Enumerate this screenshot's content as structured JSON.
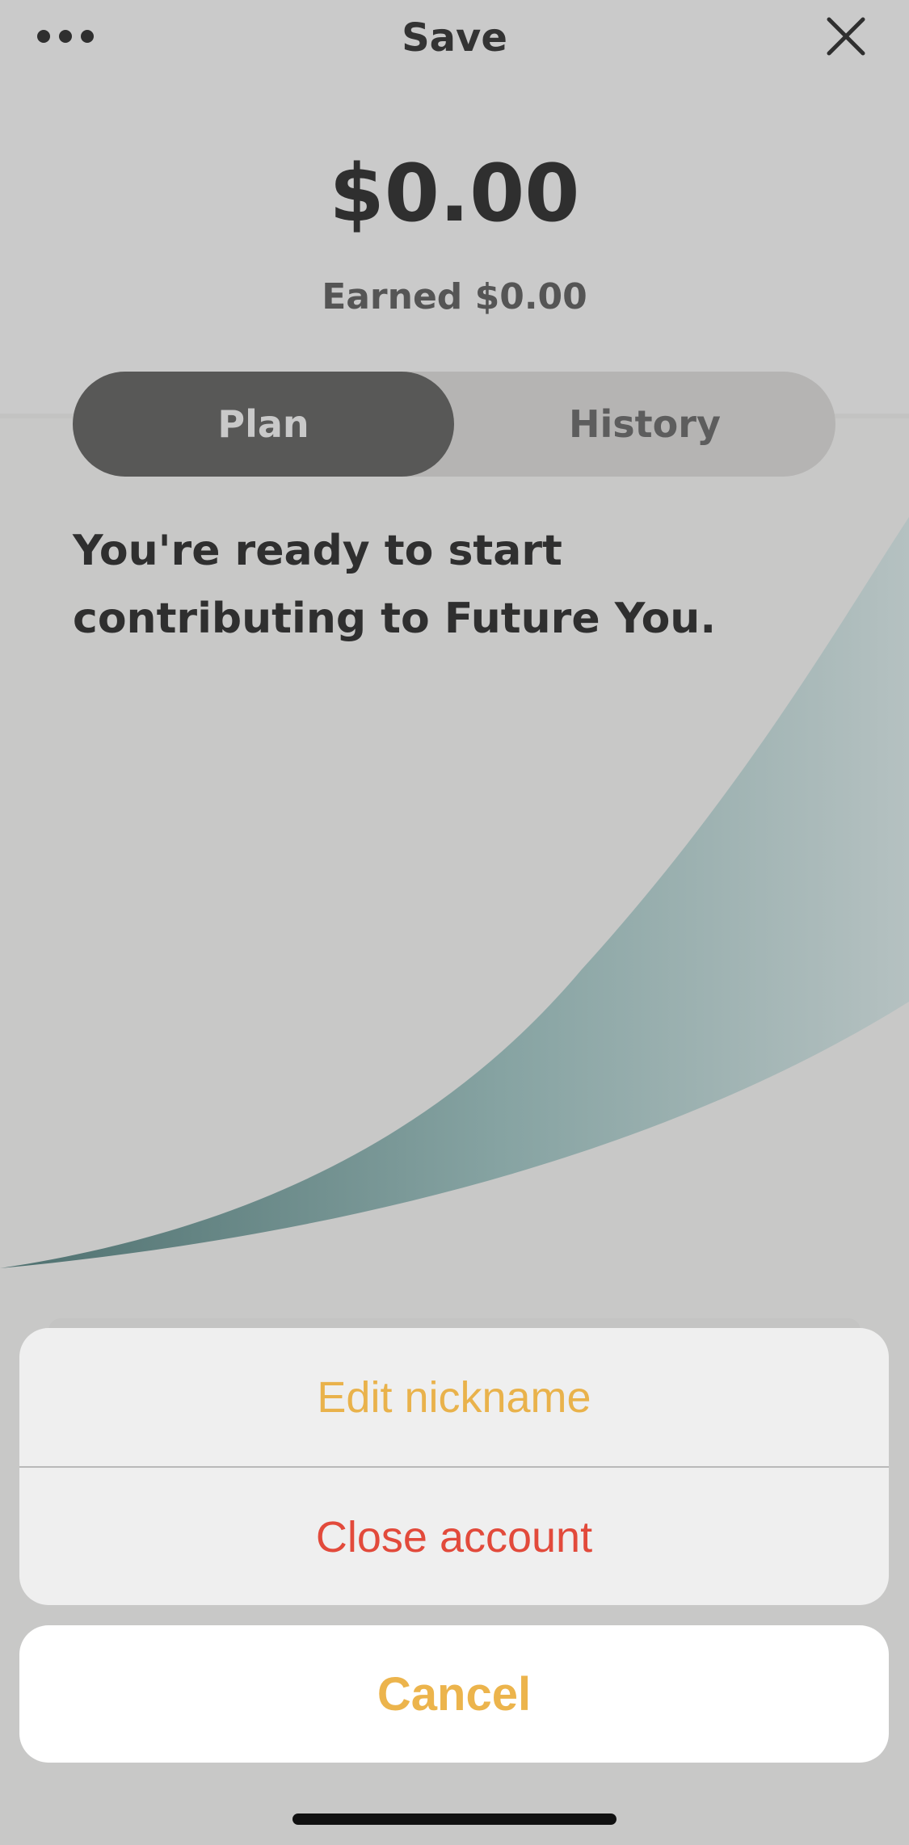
{
  "header": {
    "title": "Save",
    "menu_icon": "more-horizontal-icon",
    "close_icon": "close-icon"
  },
  "account": {
    "balance": "$0.00",
    "earned": "Earned $0.00"
  },
  "tabs": [
    {
      "label": "Plan",
      "selected": true
    },
    {
      "label": "History",
      "selected": false
    }
  ],
  "message": "You're ready to start contributing to Future You.",
  "action_sheet": {
    "items": [
      {
        "label": "Edit nickname",
        "color": "#e9b24b"
      },
      {
        "label": "Close account",
        "color": "#e24a3b"
      }
    ],
    "cancel_label": "Cancel"
  },
  "colors": {
    "accent": "#e9b24b",
    "destructive": "#e24a3b",
    "selected_tab": "#585857"
  }
}
